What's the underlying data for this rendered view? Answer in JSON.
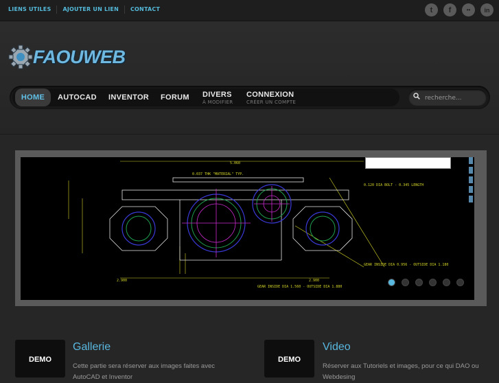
{
  "toplinks": [
    "LIENS UTILES",
    "AJOUTER UN LIEN",
    "CONTACT"
  ],
  "social": [
    {
      "name": "twitter-icon",
      "glyph": "t"
    },
    {
      "name": "facebook-icon",
      "glyph": "f"
    },
    {
      "name": "flickr-icon",
      "glyph": "••"
    },
    {
      "name": "linkedin-icon",
      "glyph": "in"
    }
  ],
  "logo": {
    "text": "FAOUWEB"
  },
  "nav": {
    "home": "HOME",
    "autocad": "AUTOCAD",
    "inventor": "INVENTOR",
    "forum": "FORUM",
    "divers": {
      "label": "DIVERS",
      "sub": "À MODIFIER"
    },
    "connexion": {
      "label": "CONNEXION",
      "sub": "CRÉER UN COMPTE"
    }
  },
  "search": {
    "placeholder": "recherche..."
  },
  "slider": {
    "dots": 6,
    "active_dot": 0
  },
  "sections": [
    {
      "badge": "DEMO",
      "title": "Gallerie",
      "text": "Cette partie sera réserver aux images faites avec AutoCAD et Inventor"
    },
    {
      "badge": "DEMO",
      "title": "Video",
      "text": "Réserver aux Tutoriels et images, pour ce qui DAO ou Webdesing"
    }
  ],
  "colors": {
    "accent": "#59b8e0",
    "background": "#262626"
  }
}
